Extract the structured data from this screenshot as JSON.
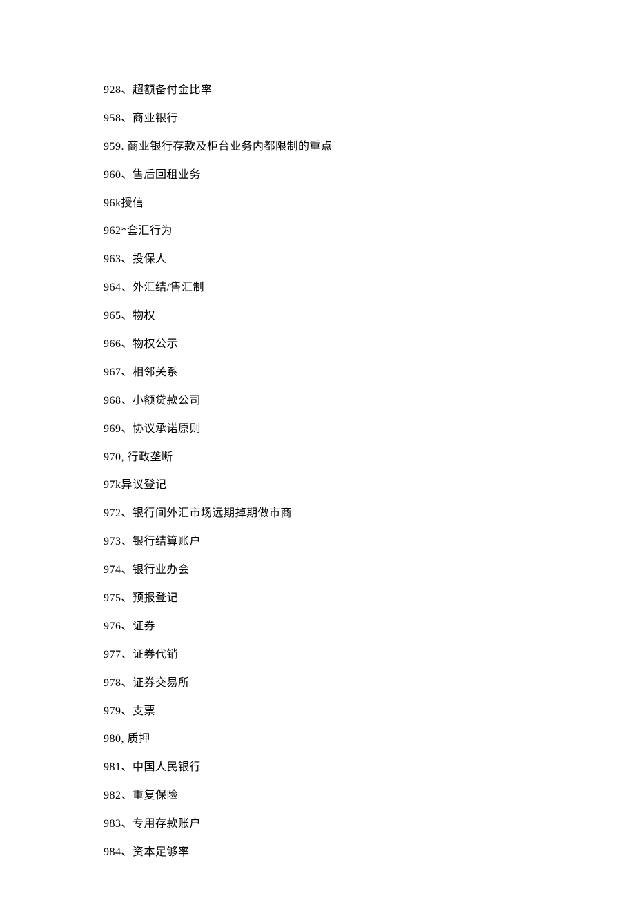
{
  "items": [
    "928、超额备付金比率",
    "958、商业银行",
    "959. 商业银行存款及柜台业务内都限制的重点",
    "960、售后回租业务",
    "96k授信",
    "962*套汇行为",
    "963、投保人",
    "964、外汇结/售汇制",
    "965、物权",
    "966、物权公示",
    "967、相邻关系",
    "968、小额贷款公司",
    "969、协议承诺原则",
    "970, 行政垄断",
    "97k异议登记",
    "972、银行间外汇市场远期掉期做市商",
    "973、银行结算账户",
    "974、银行业办会",
    "975、预报登记",
    "976、证券",
    "977、证券代销",
    "978、证券交易所",
    "979、支票",
    "980, 质押",
    "981、中国人民银行",
    "982、重复保险",
    "983、专用存款账户",
    "984、资本足够率"
  ]
}
